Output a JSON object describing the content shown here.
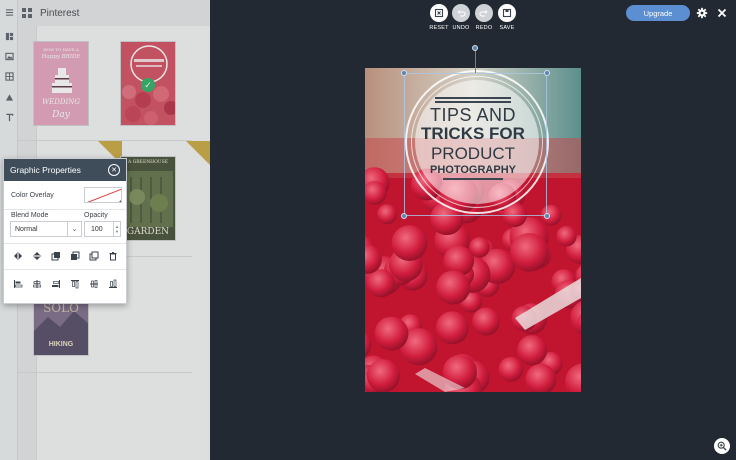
{
  "left_panel": {
    "title": "Pinterest",
    "templates": [
      {
        "lines": [
          "HOW TO HAVE A",
          "Happy BRIDE",
          "WEDDING",
          "Day"
        ]
      },
      {
        "lines": []
      },
      {
        "lines": [
          "A GREENHOUSE",
          "GARDEN"
        ]
      },
      {
        "lines": [
          "SOLO",
          "HIKING"
        ]
      }
    ]
  },
  "graphic_properties": {
    "title": "Graphic Properties",
    "color_overlay_label": "Color Overlay",
    "blend_mode_label": "Blend Mode",
    "blend_mode_value": "Normal",
    "opacity_label": "Opacity",
    "opacity_value": "100"
  },
  "toolbar": {
    "reset": "RESET",
    "undo": "UNDO",
    "redo": "REDO",
    "save": "SAVE",
    "upgrade": "Upgrade"
  },
  "canvas": {
    "line1": "TIPS AND",
    "line2": "TRICKS FOR",
    "line3": "PRODUCT",
    "line4": "PHOTOGRAPHY"
  },
  "colors": {
    "workspace": "#222933",
    "accent": "#5b8fd1",
    "dialog_header": "#3f4d5a"
  }
}
